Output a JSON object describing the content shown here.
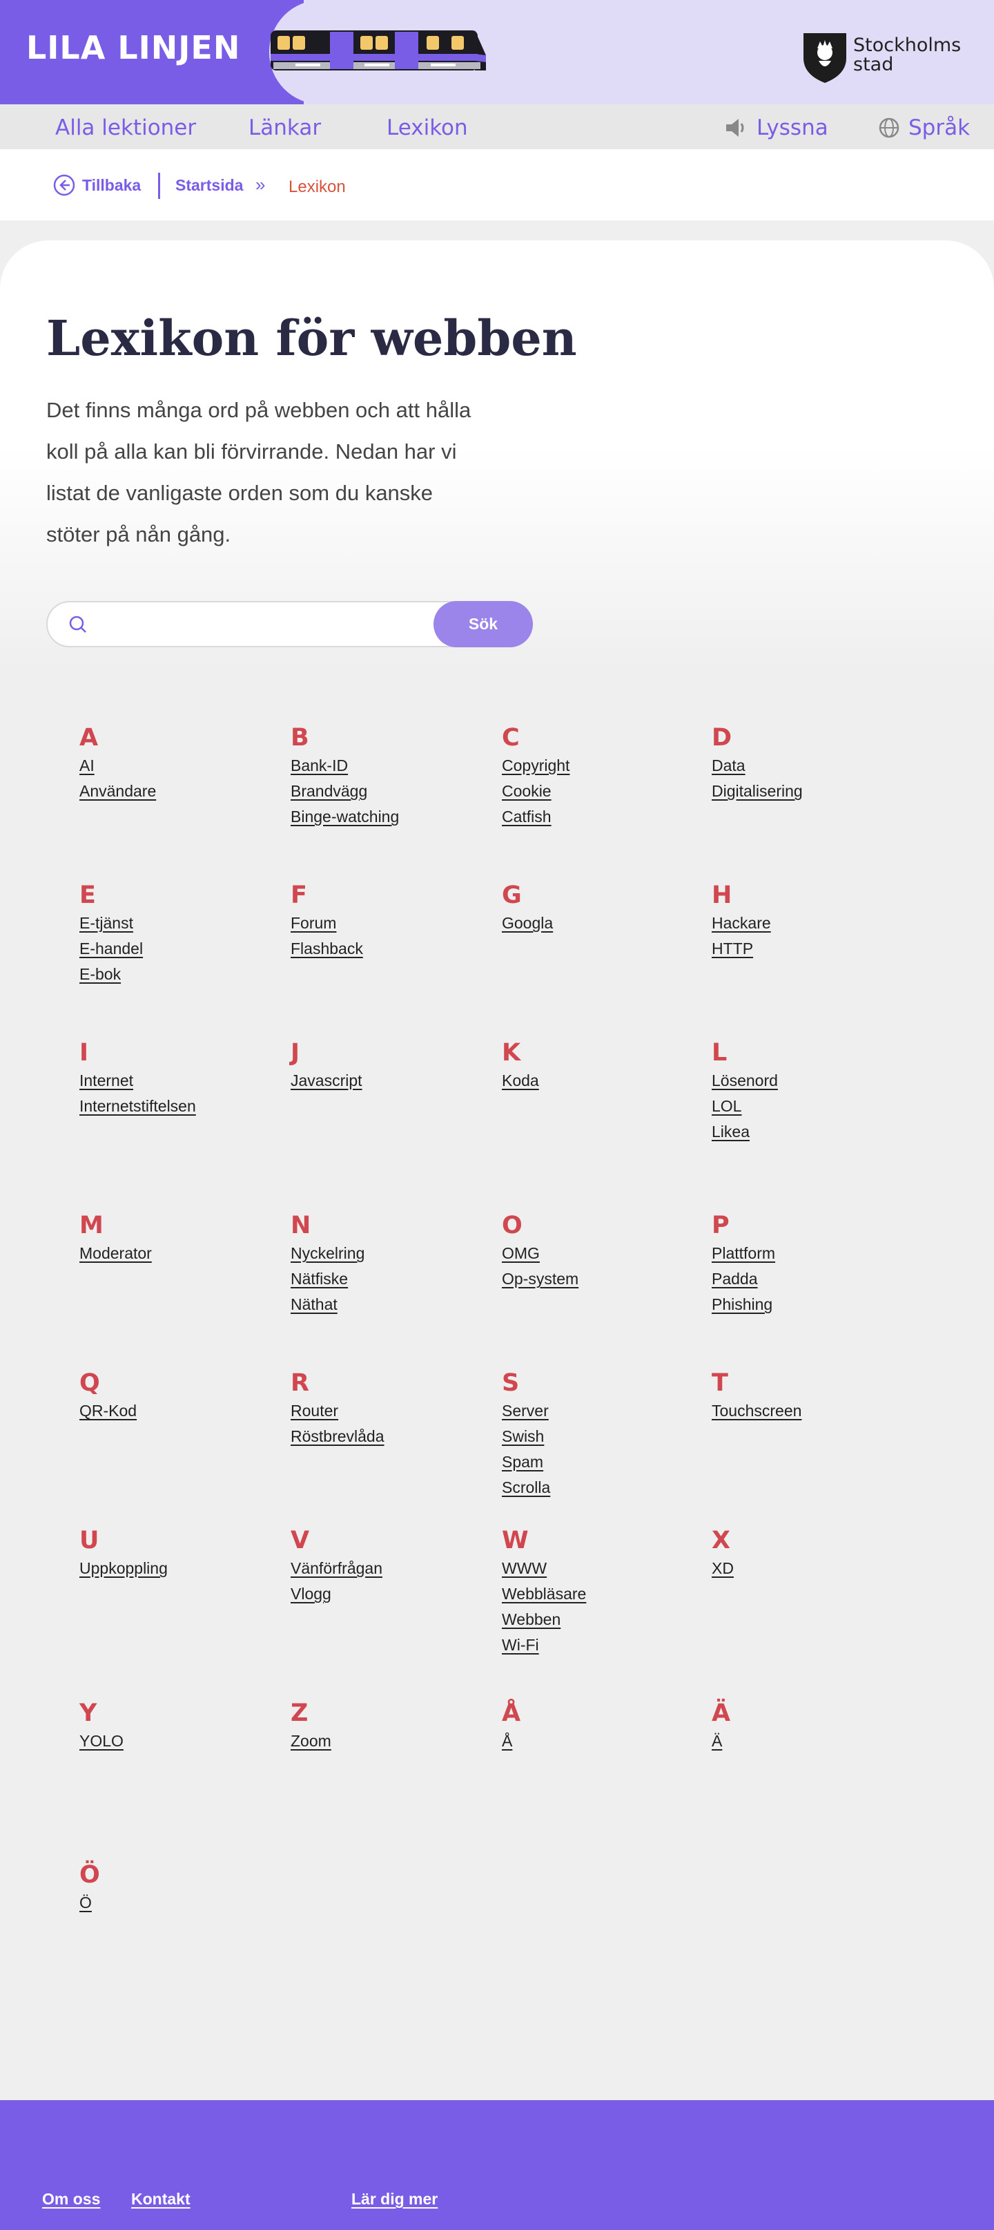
{
  "header": {
    "site_title": "LILA LINJEN",
    "logo_text_line1": "Stockholms",
    "logo_text_line2": "stad"
  },
  "nav": {
    "items": [
      {
        "label": "Alla lektioner"
      },
      {
        "label": "Länkar"
      },
      {
        "label": "Lexikon"
      }
    ],
    "listen_label": "Lyssna",
    "language_label": "Språk"
  },
  "breadcrumb": {
    "back_label": "Tillbaka",
    "home_label": "Startsida",
    "separator": "»",
    "current_label": "Lexikon"
  },
  "main": {
    "title": "Lexikon för webben",
    "intro": "Det finns många ord på webben och att hålla koll på alla kan bli förvirrande. Nedan har vi listat de vanligaste orden som du kanske stöter på nån gång.",
    "search": {
      "placeholder": "",
      "button_label": "Sök"
    }
  },
  "lexicon": [
    {
      "letter": "A",
      "terms": [
        "AI",
        "Användare"
      ]
    },
    {
      "letter": "B",
      "terms": [
        "Bank-ID",
        "Brandvägg",
        "Binge-watching"
      ]
    },
    {
      "letter": "C",
      "terms": [
        "Copyright",
        "Cookie",
        "Catfish"
      ]
    },
    {
      "letter": "D",
      "terms": [
        "Data",
        "Digitalisering"
      ]
    },
    {
      "letter": "E",
      "terms": [
        "E-tjänst",
        "E-handel",
        "E-bok"
      ]
    },
    {
      "letter": "F",
      "terms": [
        "Forum",
        "Flashback"
      ]
    },
    {
      "letter": "G",
      "terms": [
        "Googla"
      ]
    },
    {
      "letter": "H",
      "terms": [
        "Hackare",
        "HTTP"
      ]
    },
    {
      "letter": "I",
      "terms": [
        "Internet",
        "Internetstiftelsen"
      ]
    },
    {
      "letter": "J",
      "terms": [
        "Javascript"
      ]
    },
    {
      "letter": "K",
      "terms": [
        "Koda"
      ]
    },
    {
      "letter": "L",
      "terms": [
        "Lösenord",
        "LOL",
        "Likea"
      ]
    },
    {
      "letter": "M",
      "terms": [
        "Moderator"
      ]
    },
    {
      "letter": "N",
      "terms": [
        "Nyckelring",
        "Nätfiske",
        "Näthat"
      ]
    },
    {
      "letter": "O",
      "terms": [
        "OMG",
        "Op-system"
      ]
    },
    {
      "letter": "P",
      "terms": [
        "Plattform",
        "Padda",
        "Phishing"
      ]
    },
    {
      "letter": "Q",
      "terms": [
        "QR-Kod"
      ]
    },
    {
      "letter": "R",
      "terms": [
        "Router",
        "Röstbrevlåda"
      ]
    },
    {
      "letter": "S",
      "terms": [
        "Server",
        "Swish",
        "Spam",
        "Scrolla"
      ]
    },
    {
      "letter": "T",
      "terms": [
        "Touchscreen"
      ]
    },
    {
      "letter": "U",
      "terms": [
        "Uppkoppling"
      ]
    },
    {
      "letter": "V",
      "terms": [
        "Vänförfrågan",
        "Vlogg"
      ]
    },
    {
      "letter": "W",
      "terms": [
        "WWW",
        "Webbläsare",
        "Webben",
        "Wi-Fi"
      ]
    },
    {
      "letter": "X",
      "terms": [
        "XD"
      ]
    },
    {
      "letter": "Y",
      "terms": [
        "YOLO"
      ]
    },
    {
      "letter": "Z",
      "terms": [
        "Zoom"
      ]
    },
    {
      "letter": "Å",
      "terms": [
        "Å"
      ]
    },
    {
      "letter": "Ä",
      "terms": [
        "Ä"
      ]
    },
    {
      "letter": "Ö",
      "terms": [
        "Ö"
      ]
    }
  ],
  "footer": {
    "links": [
      {
        "label": "Om oss"
      },
      {
        "label": "Kontakt"
      },
      {
        "label": "Lär dig mer"
      }
    ]
  },
  "colors": {
    "brand_purple": "#7a5de6",
    "header_lilac": "#e0dcf7",
    "letter_red": "#d0474f",
    "breadcrumb_current": "#d6533c",
    "search_button": "#9b84ea"
  }
}
